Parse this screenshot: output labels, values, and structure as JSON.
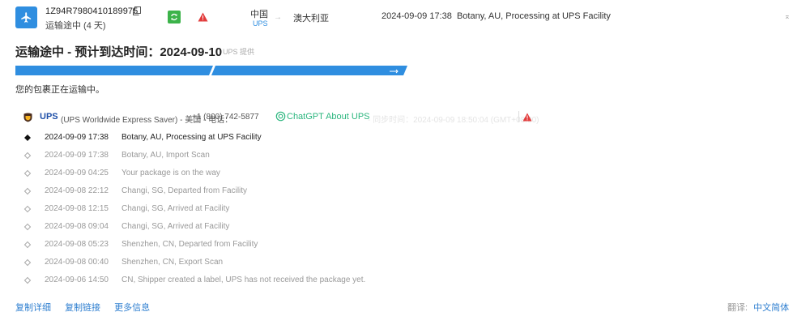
{
  "header": {
    "tracking_number": "1Z94R7980410189975",
    "status_sub": "运输途中 (4 天)",
    "origin": "中国",
    "carrier_short": "UPS",
    "arrow": "→",
    "destination": "澳大利亚",
    "latest_event": "2024-09-09 17:38  Botany, AU, Processing at UPS Facility",
    "expand_glyph": "⌅",
    "accent": "#2f8ee0",
    "sync_color": "#3cb34a",
    "warning_color": "#e23c3c"
  },
  "title": {
    "text": "运输途中 - 预计到达时间：2024-09-10",
    "provider": "UPS 提供"
  },
  "progress": {
    "fraction": 1.0,
    "segments": 2
  },
  "info_text": "您的包裹正在运输中。",
  "carrier": {
    "name": "UPS",
    "service": "(UPS Worldwide Express Saver) - 美国 - 电话：",
    "phone": "+1 (800) 742-5877",
    "gpt_link": "ChatGPT About UPS",
    "sync_time": "- 同步时间：2024-09-09 18:50:04 (GMT+08:00)"
  },
  "events": [
    {
      "time": "2024-09-09 17:38",
      "desc": "Botany, AU, Processing at UPS Facility"
    },
    {
      "time": "2024-09-09 17:38",
      "desc": "Botany, AU, Import Scan"
    },
    {
      "time": "2024-09-09 04:25",
      "desc": "Your package is on the way"
    },
    {
      "time": "2024-09-08 22:12",
      "desc": "Changi, SG, Departed from Facility"
    },
    {
      "time": "2024-09-08 12:15",
      "desc": "Changi, SG, Arrived at Facility"
    },
    {
      "time": "2024-09-08 09:04",
      "desc": "Changi, SG, Arrived at Facility"
    },
    {
      "time": "2024-09-08 05:23",
      "desc": "Shenzhen, CN, Departed from Facility"
    },
    {
      "time": "2024-09-08 00:40",
      "desc": "Shenzhen, CN, Export Scan"
    },
    {
      "time": "2024-09-06 14:50",
      "desc": "CN, Shipper created a label, UPS has not received the package yet."
    }
  ],
  "footer": {
    "copy_detail": "复制详细",
    "copy_link": "复制链接",
    "more_info": "更多信息",
    "translate_label": "翻译:",
    "language": "中文简体"
  }
}
